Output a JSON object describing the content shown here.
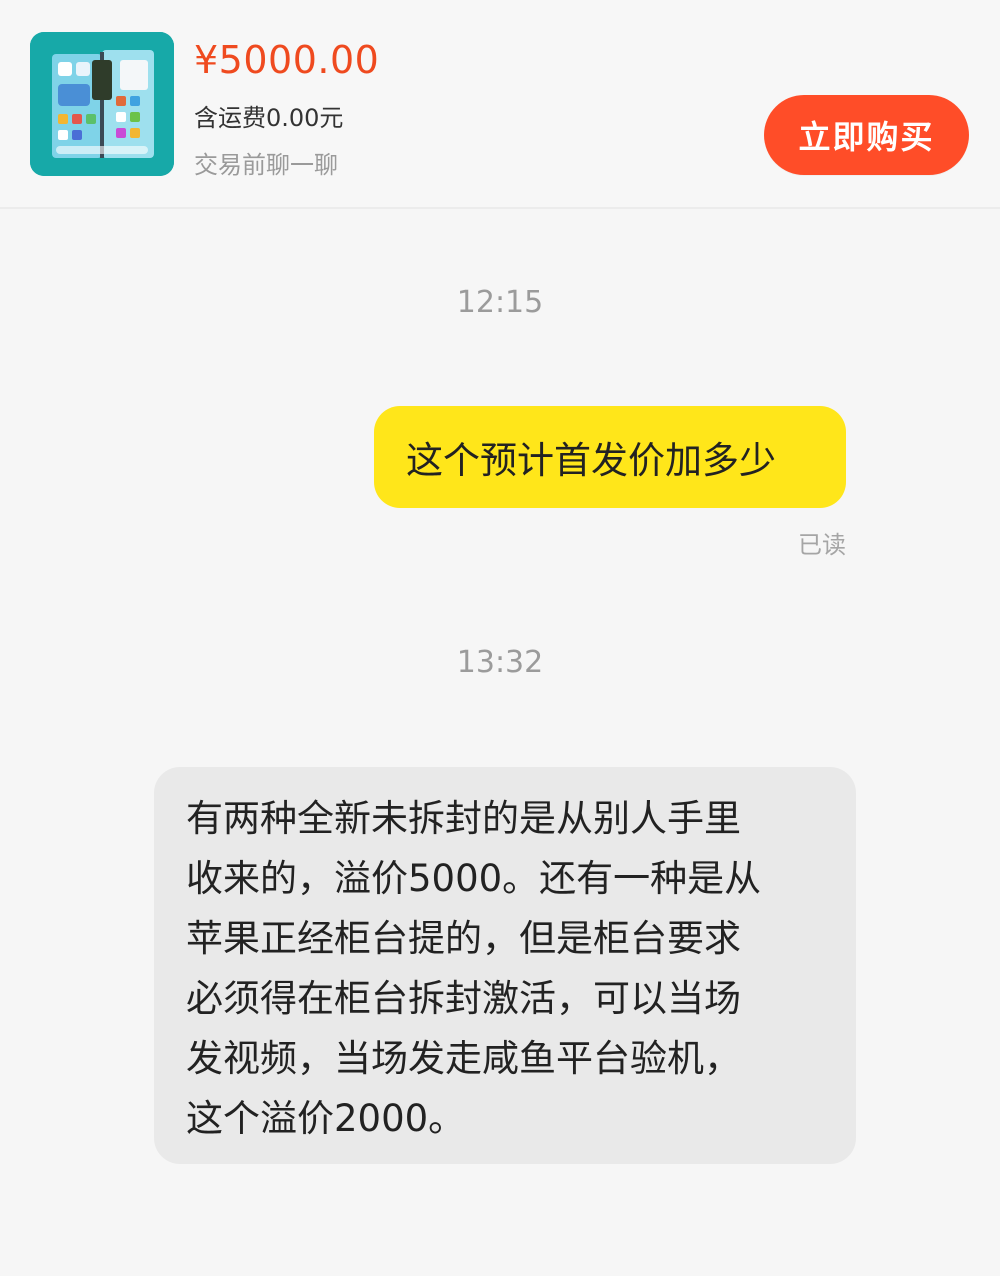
{
  "product": {
    "price": "¥5000.00",
    "shipping": "含运费0.00元",
    "hint": "交易前聊一聊",
    "buy_label": "立即购买",
    "thumbnail_icon": "folding-phone-image"
  },
  "chat": {
    "messages": [
      {
        "time": "12:15",
        "direction": "outgoing",
        "text": "这个预计首发价加多少",
        "status": "已读"
      },
      {
        "time": "13:32",
        "direction": "incoming",
        "lines": [
          "有两种全新未拆封的是从别人手里",
          "收来的，溢价5000。还有一种是从",
          "苹果正经柜台提的，但是柜台要求",
          "必须得在柜台拆封激活，可以当场",
          "发视频，当场发走咸鱼平台验机，",
          "这个溢价2000。"
        ]
      }
    ]
  },
  "colors": {
    "price": "#ef4a1f",
    "buy_button": "#ff4d28",
    "outgoing_bubble": "#ffe61a",
    "incoming_bubble": "#e9e9e9",
    "background": "#f6f6f6"
  }
}
